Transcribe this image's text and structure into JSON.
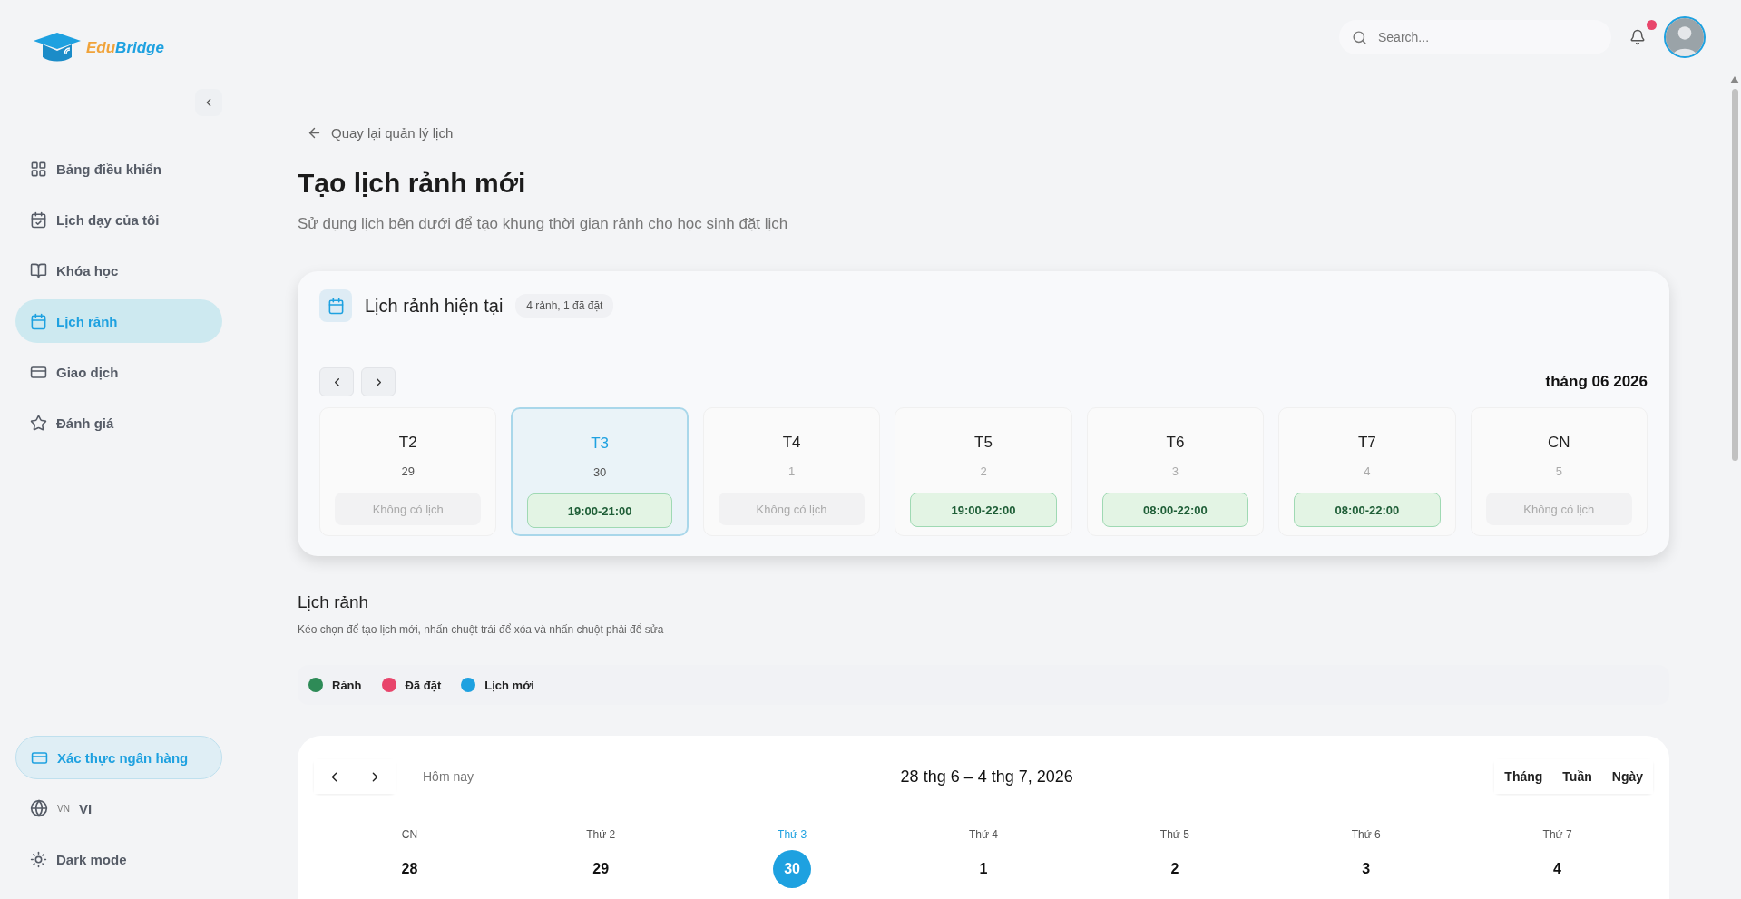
{
  "brand": {
    "name_part1": "Edu",
    "name_part2": "Bridge"
  },
  "sidebar": {
    "items": [
      {
        "label": "Bảng điều khiển",
        "selected": false
      },
      {
        "label": "Lịch dạy của tôi",
        "selected": false
      },
      {
        "label": "Khóa học",
        "selected": false
      },
      {
        "label": "Lịch rảnh",
        "selected": true
      },
      {
        "label": "Giao dịch",
        "selected": false
      },
      {
        "label": "Đánh giá",
        "selected": false
      }
    ],
    "bottom": {
      "bank": "Xác thực ngân hàng",
      "lang_code": "VN",
      "lang": "VI",
      "dark_mode": "Dark mode"
    }
  },
  "header": {
    "search_placeholder": "Search...",
    "has_notification": true
  },
  "back_link": "Quay lại quản lý lịch",
  "title": "Tạo lịch rảnh mới",
  "subtitle": "Sử dụng lịch bên dưới để tạo khung thời gian rảnh cho học sinh đặt lịch",
  "current": {
    "title": "Lịch rảnh hiện tại",
    "badge": "4 rảnh, 1 đã đặt",
    "month": "tháng 06 2026",
    "days": [
      {
        "weekday": "T2",
        "date": "29",
        "slot": "Không có lịch",
        "kind": "empty",
        "selected": false,
        "muted": false
      },
      {
        "weekday": "T3",
        "date": "30",
        "slot": "19:00-21:00",
        "kind": "free",
        "selected": true,
        "muted": false
      },
      {
        "weekday": "T4",
        "date": "1",
        "slot": "Không có lịch",
        "kind": "empty",
        "selected": false,
        "muted": true
      },
      {
        "weekday": "T5",
        "date": "2",
        "slot": "19:00-22:00",
        "kind": "free",
        "selected": false,
        "muted": true
      },
      {
        "weekday": "T6",
        "date": "3",
        "slot": "08:00-22:00",
        "kind": "free",
        "selected": false,
        "muted": true
      },
      {
        "weekday": "T7",
        "date": "4",
        "slot": "08:00-22:00",
        "kind": "free",
        "selected": false,
        "muted": true
      },
      {
        "weekday": "CN",
        "date": "5",
        "slot": "Không có lịch",
        "kind": "empty",
        "selected": false,
        "muted": true
      }
    ]
  },
  "schedule": {
    "title": "Lịch rảnh",
    "hint": "Kéo chọn để tạo lịch mới, nhấn chuột trái để xóa và nhấn chuột phải để sửa",
    "legend": [
      {
        "label": "Rảnh",
        "color": "#2e8b57"
      },
      {
        "label": "Đã đặt",
        "color": "#e8456b"
      },
      {
        "label": "Lịch mới",
        "color": "#1ea1e0"
      }
    ]
  },
  "calendar": {
    "today_button": "Hôm nay",
    "range": "28 thg 6 – 4 thg 7, 2026",
    "views": [
      "Tháng",
      "Tuần",
      "Ngày"
    ],
    "days": [
      {
        "weekday": "CN",
        "date": "28",
        "today": false
      },
      {
        "weekday": "Thứ 2",
        "date": "29",
        "today": false
      },
      {
        "weekday": "Thứ 3",
        "date": "30",
        "today": true
      },
      {
        "weekday": "Thứ 4",
        "date": "1",
        "today": false
      },
      {
        "weekday": "Thứ 5",
        "date": "2",
        "today": false
      },
      {
        "weekday": "Thứ 6",
        "date": "3",
        "today": false
      },
      {
        "weekday": "Thứ 7",
        "date": "4",
        "today": false
      }
    ]
  }
}
